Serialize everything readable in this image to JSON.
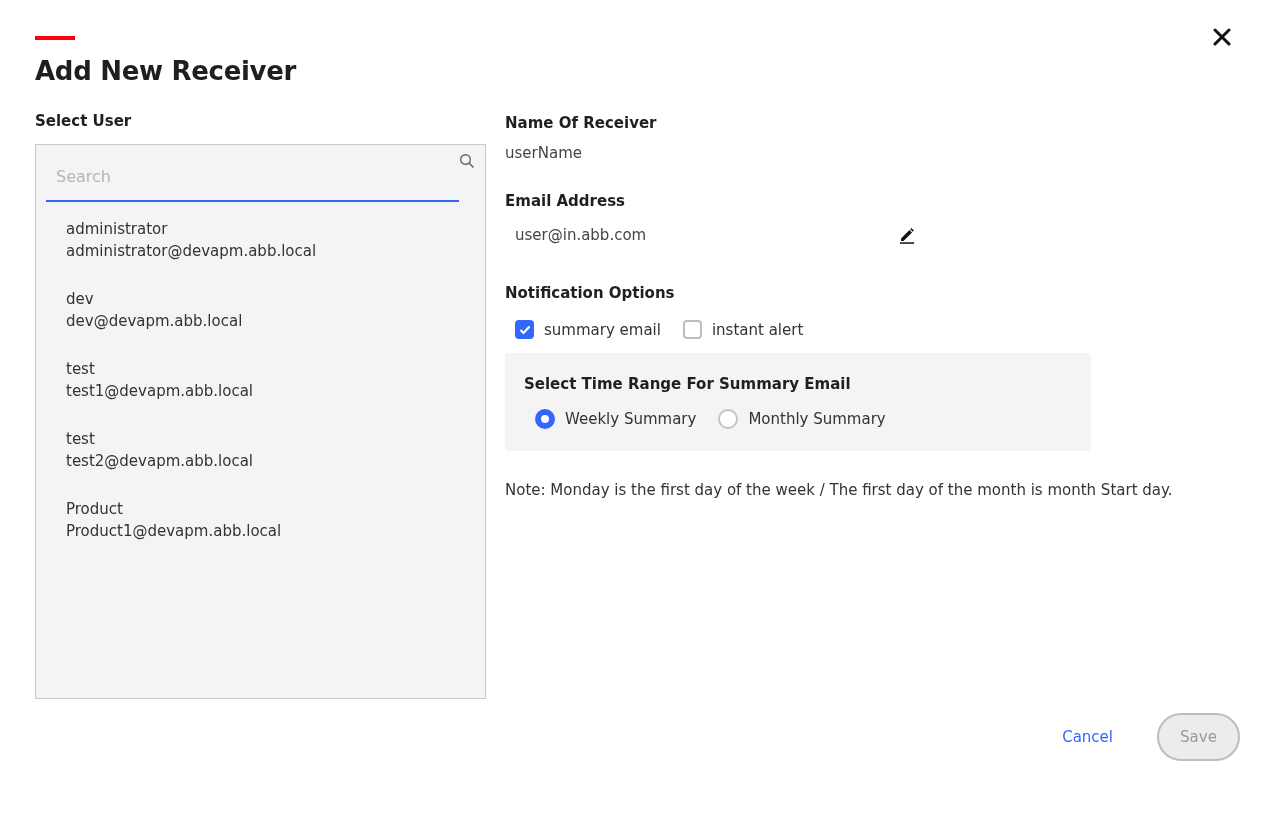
{
  "dialog": {
    "title": "Add New Receiver"
  },
  "select_user": {
    "label": "Select User",
    "search": {
      "placeholder": "Search"
    },
    "users": [
      {
        "name": "administrator",
        "email": "administrator@devapm.abb.local"
      },
      {
        "name": "dev",
        "email": "dev@devapm.abb.local"
      },
      {
        "name": "test",
        "email": "test1@devapm.abb.local"
      },
      {
        "name": "test",
        "email": "test2@devapm.abb.local"
      },
      {
        "name": "Product",
        "email": "Product1@devapm.abb.local"
      }
    ]
  },
  "receiver_name": {
    "label": "Name Of Receiver",
    "value": "userName"
  },
  "email_address": {
    "label": "Email Address",
    "value": "user@in.abb.com"
  },
  "notification_options": {
    "label": "Notification Options",
    "options": [
      {
        "label": "summary email",
        "checked": true
      },
      {
        "label": "instant alert",
        "checked": false
      }
    ]
  },
  "time_range": {
    "label": "Select Time Range For Summary Email",
    "options": [
      {
        "label": "Weekly Summary",
        "selected": true
      },
      {
        "label": "Monthly Summary",
        "selected": false
      }
    ]
  },
  "note": "Note: Monday is the first day of the week / The first day of the month is month Start day.",
  "buttons": [
    {
      "kind": "link",
      "label": "Cancel",
      "disabled": false
    },
    {
      "kind": "pill",
      "label": "Save",
      "disabled": true
    }
  ]
}
